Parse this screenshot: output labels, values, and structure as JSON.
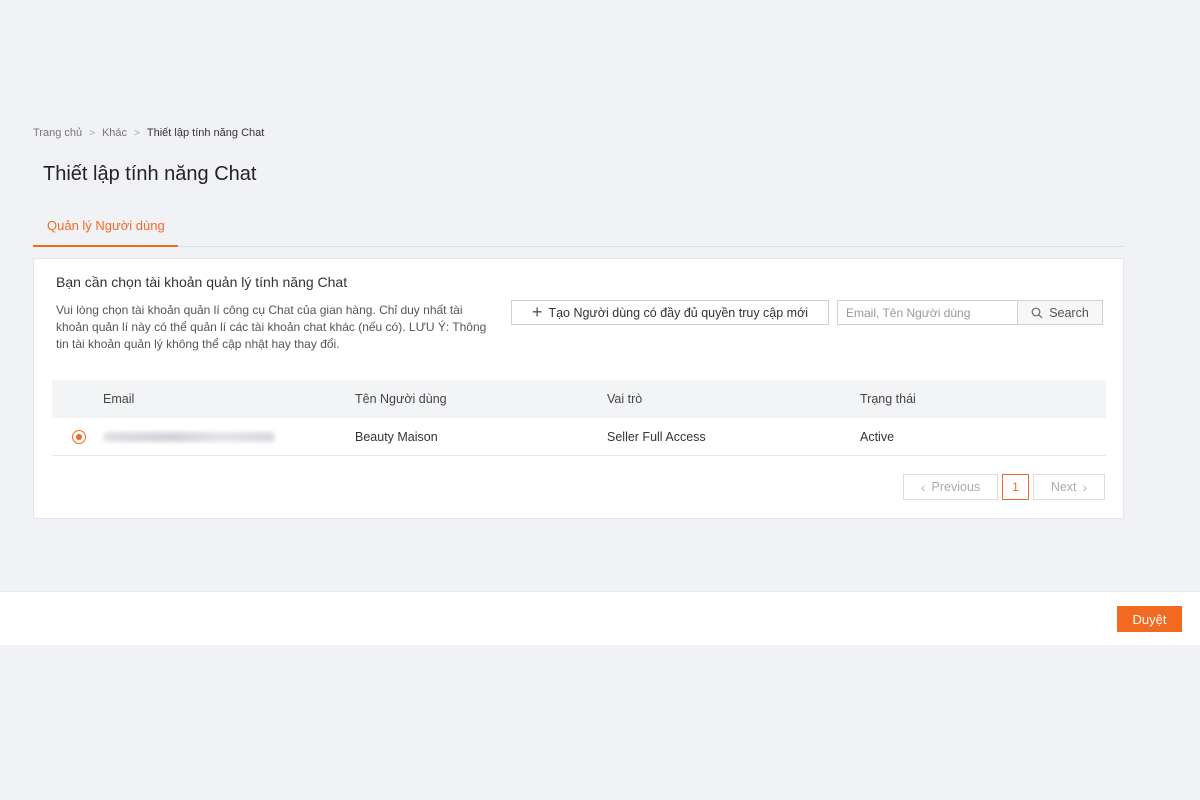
{
  "breadcrumb": {
    "items": [
      "Trang chủ",
      "Khác"
    ],
    "separator": ">",
    "current": "Thiết lập tính năng Chat"
  },
  "page": {
    "title": "Thiết lập tính năng Chat"
  },
  "tabs": [
    {
      "label": "Quản lý Người dùng",
      "active": true
    }
  ],
  "card": {
    "heading": "Bạn cần chọn tài khoản quản lý tính năng Chat",
    "description": "Vui lòng chọn tài khoản quản lí công cụ Chat của gian hàng. Chỉ duy nhất tài khoản quản lí này có thể quản lí các tài khoản chat khác (nếu có). LƯU Ý: Thông tin tài khoản quản lý không thể cập nhật hay thay đổi.",
    "create_button": "Tạo Người dùng có đầy đủ quyền truy cập mới",
    "search": {
      "placeholder": "Email, Tên Người dùng",
      "value": "",
      "button": "Search",
      "icon": "search-icon"
    }
  },
  "table": {
    "columns": [
      "Email",
      "Tên Người dùng",
      "Vai trò",
      "Trạng thái"
    ],
    "rows": [
      {
        "selected": true,
        "email": "",
        "name": "Beauty Maison",
        "role": "Seller Full Access",
        "status": "Active"
      }
    ]
  },
  "pagination": {
    "previous": "Previous",
    "next": "Next",
    "current_page": "1"
  },
  "footer": {
    "approve_button": "Duyệt"
  },
  "colors": {
    "accent": "#f26a22",
    "background": "#f1f2f5"
  }
}
